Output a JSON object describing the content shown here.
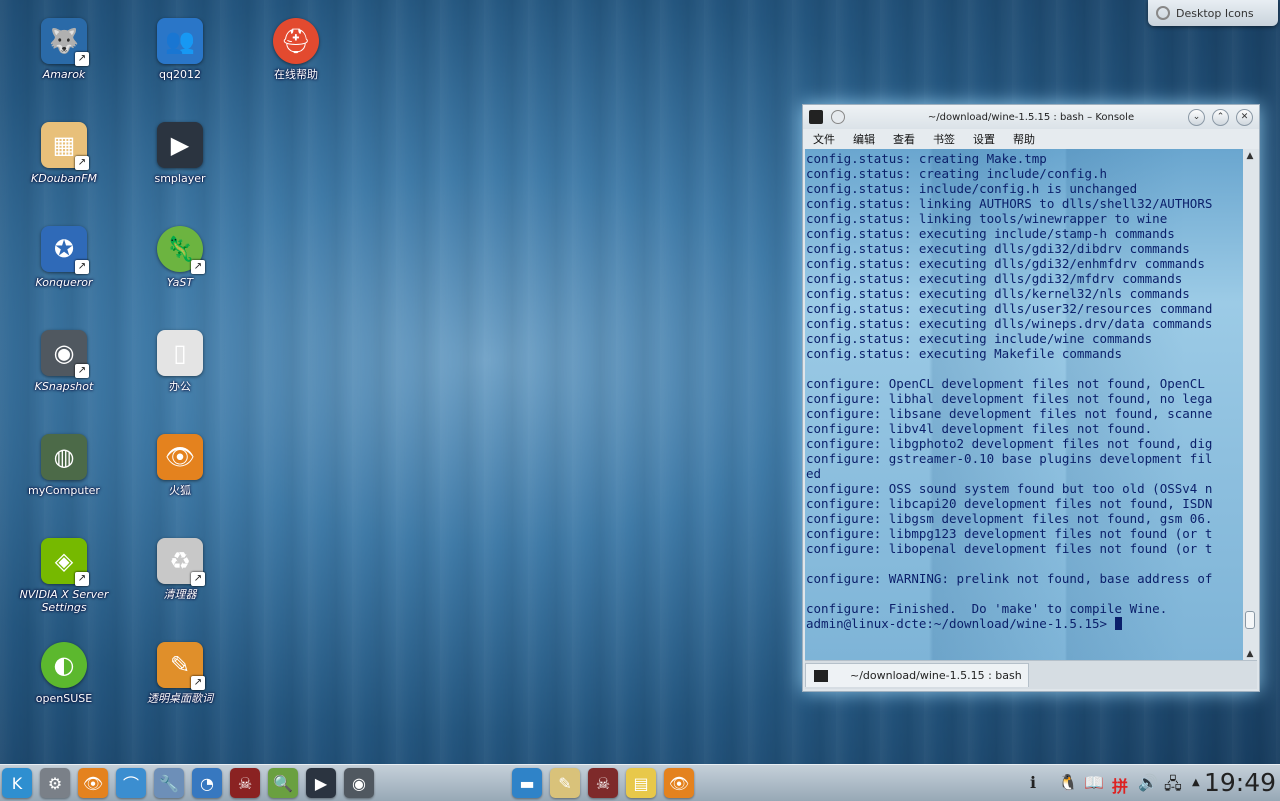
{
  "desktop": {
    "icons": [
      {
        "label": "Amarok",
        "italic": true,
        "color": "#2a6aa8",
        "glyph": "🐺"
      },
      {
        "label": "qq2012",
        "italic": false,
        "color": "#2a76c8",
        "glyph": "👥"
      },
      {
        "label": "在线帮助",
        "italic": false,
        "color": "#e34a2f",
        "glyph": "⛑"
      },
      {
        "label": "KDoubanFM",
        "italic": true,
        "color": "#e8c07a",
        "glyph": "▦"
      },
      {
        "label": "smplayer",
        "italic": false,
        "color": "#2b3440",
        "glyph": "▶"
      },
      {
        "label": "Konqueror",
        "italic": true,
        "color": "#2f6ab8",
        "glyph": "✪"
      },
      {
        "label": "YaST",
        "italic": true,
        "color": "#6cb440",
        "glyph": "🦎"
      },
      {
        "label": "KSnapshot",
        "italic": true,
        "color": "#505860",
        "glyph": "◉"
      },
      {
        "label": "办公",
        "italic": false,
        "color": "#e4e4e4",
        "glyph": "▯"
      },
      {
        "label": "myComputer",
        "italic": false,
        "color": "#4c6a48",
        "glyph": "◍"
      },
      {
        "label": "火狐",
        "italic": false,
        "color": "#e4821e",
        "glyph": "👁"
      },
      {
        "label": "NVIDIA X Server Settings",
        "italic": true,
        "color": "#76b900",
        "glyph": "◈"
      },
      {
        "label": "清理器",
        "italic": true,
        "color": "#c8c8c8",
        "glyph": "♻"
      },
      {
        "label": "openSUSE",
        "italic": false,
        "color": "#5cb82e",
        "glyph": "◐"
      },
      {
        "label": "透明桌面歌词",
        "italic": true,
        "color": "#e08f2a",
        "glyph": "✎"
      }
    ]
  },
  "toolbox": {
    "label": "Desktop Icons"
  },
  "konsole": {
    "title": "~/download/wine-1.5.15 : bash – Konsole",
    "menu": [
      "文件",
      "编辑",
      "查看",
      "书签",
      "设置",
      "帮助"
    ],
    "buttons": {
      "minimize": "⌄",
      "maximize": "⌃",
      "close": "✕"
    },
    "output": "config.status: creating Make.tmp\nconfig.status: creating include/config.h\nconfig.status: include/config.h is unchanged\nconfig.status: linking AUTHORS to dlls/shell32/AUTHORS\nconfig.status: linking tools/winewrapper to wine\nconfig.status: executing include/stamp-h commands\nconfig.status: executing dlls/gdi32/dibdrv commands\nconfig.status: executing dlls/gdi32/enhmfdrv commands\nconfig.status: executing dlls/gdi32/mfdrv commands\nconfig.status: executing dlls/kernel32/nls commands\nconfig.status: executing dlls/user32/resources command\nconfig.status: executing dlls/wineps.drv/data commands\nconfig.status: executing include/wine commands\nconfig.status: executing Makefile commands\n\nconfigure: OpenCL development files not found, OpenCL\nconfigure: libhal development files not found, no lega\nconfigure: libsane development files not found, scanne\nconfigure: libv4l development files not found.\nconfigure: libgphoto2 development files not found, dig\nconfigure: gstreamer-0.10 base plugins development fil\ned\nconfigure: OSS sound system found but too old (OSSv4 n\nconfigure: libcapi20 development files not found, ISDN\nconfigure: libgsm development files not found, gsm 06.\nconfigure: libmpg123 development files not found (or t\nconfigure: libopenal development files not found (or t\n\nconfigure: WARNING: prelink not found, base address of\n\nconfigure: Finished.  Do 'make' to compile Wine.\n",
    "prompt": "admin@linux-dcte:~/download/wine-1.5.15> ",
    "tab_label": "~/download/wine-1.5.15 : bash"
  },
  "taskbar": {
    "launchers": [
      {
        "name": "kickoff-launcher",
        "color": "#2e8fd0",
        "glyph": "K"
      },
      {
        "name": "app-grid",
        "color": "#7a8088",
        "glyph": "⚙"
      },
      {
        "name": "firefox",
        "color": "#e4821e",
        "glyph": "👁"
      },
      {
        "name": "dolphin",
        "color": "#3b8ed0",
        "glyph": "⌒"
      },
      {
        "name": "systemsettings",
        "color": "#6d8fb8",
        "glyph": "🔧"
      },
      {
        "name": "konqueror",
        "color": "#3778c0",
        "glyph": "◔"
      },
      {
        "name": "wine",
        "color": "#8a2222",
        "glyph": "☠"
      },
      {
        "name": "magnifier",
        "color": "#6aa040",
        "glyph": "🔍"
      },
      {
        "name": "smplayer",
        "color": "#2b3440",
        "glyph": "▶"
      },
      {
        "name": "ksnapshot",
        "color": "#505860",
        "glyph": "◉"
      }
    ],
    "tasks": [
      {
        "name": "konsole-task",
        "color": "#2f83c8",
        "glyph": "▬"
      },
      {
        "name": "kate-task",
        "color": "#d9c27a",
        "glyph": "✎"
      },
      {
        "name": "wine-task",
        "color": "#7e2a2a",
        "glyph": "☠"
      },
      {
        "name": "notes-task",
        "color": "#e8c84a",
        "glyph": "▤"
      },
      {
        "name": "firefox-task",
        "color": "#e4821e",
        "glyph": "👁"
      }
    ],
    "tray": [
      "ℹ",
      "🐧",
      "📖",
      "拼",
      "🔊",
      "🖧",
      "▲"
    ],
    "clock": "19:49"
  }
}
